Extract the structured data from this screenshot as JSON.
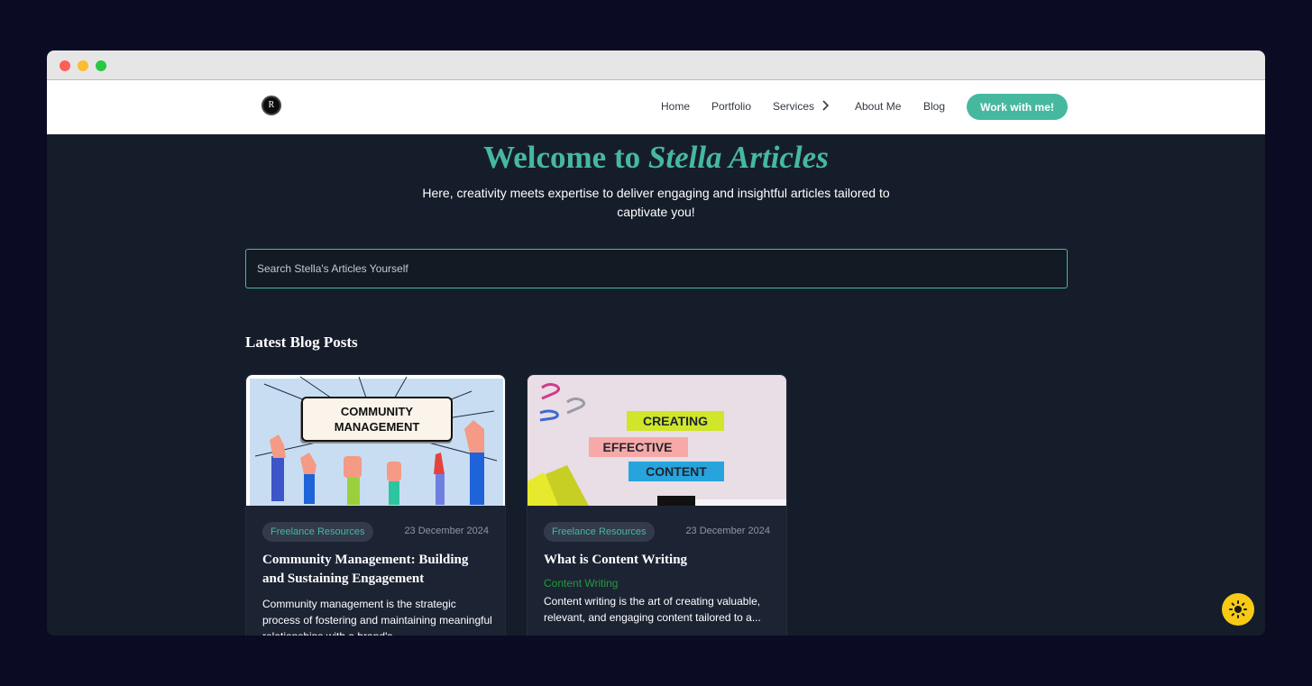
{
  "window": {
    "controls": [
      "close",
      "minimize",
      "maximize"
    ]
  },
  "nav": {
    "logo_text": "R",
    "links": [
      "Home",
      "Portfolio",
      "Services",
      "About Me",
      "Blog"
    ],
    "cta": "Work with me!"
  },
  "hero": {
    "title_prefix": "Welcome to",
    "title_highlight": "Stella Articles",
    "subtitle": "Here, creativity meets expertise to deliver engaging and insightful articles tailored to captivate you!"
  },
  "search": {
    "placeholder": "Search Stella's Articles Yourself"
  },
  "section_title": "Latest Blog Posts",
  "posts": [
    {
      "image_text": [
        "COMMUNITY",
        "MANAGEMENT"
      ],
      "category": "Freelance Resources",
      "date": "23 December 2024",
      "title": "Community Management: Building and Sustaining Engagement",
      "subtitle": "",
      "excerpt": "Community management is the strategic process of fostering and maintaining meaningful relationships with a brand's..."
    },
    {
      "image_text": [
        "CREATING",
        "EFFECTIVE",
        "CONTENT"
      ],
      "category": "Freelance Resources",
      "date": "23 December 2024",
      "title": "What is Content Writing",
      "subtitle": "Content Writing",
      "excerpt": "Content writing is the art of creating valuable, relevant, and engaging content tailored to a..."
    }
  ],
  "colors": {
    "accent": "#46b8a0",
    "background": "#161d2a",
    "theme_button": "#f7cb15"
  },
  "icons": {
    "services_chevron": "chevron-right-icon",
    "theme_toggle": "sun-icon"
  }
}
